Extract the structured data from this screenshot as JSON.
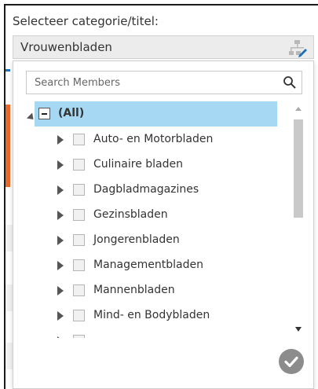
{
  "filter": {
    "label": "Selecteer categorie/titel:",
    "selected_value": "Vrouwenbladen"
  },
  "search": {
    "placeholder": "Search Members",
    "value": ""
  },
  "tree": {
    "all_label": "(All)",
    "items": [
      {
        "label": "Auto- en Motorbladen"
      },
      {
        "label": "Culinaire bladen"
      },
      {
        "label": "Dagbladmagazines"
      },
      {
        "label": "Gezinsbladen"
      },
      {
        "label": "Jongerenbladen"
      },
      {
        "label": "Managementbladen"
      },
      {
        "label": "Mannenbladen"
      },
      {
        "label": "Mind- en Bodybladen"
      }
    ]
  },
  "colors": {
    "selection": "#a6d8f3",
    "accent_orange": "#e8692a",
    "accent_blue": "#1d6fb8",
    "ok_button": "#8c8c8c"
  },
  "icons": {
    "hierarchy": "hierarchy-edit-icon",
    "search": "search-icon",
    "ok": "checkmark-circle-icon"
  }
}
